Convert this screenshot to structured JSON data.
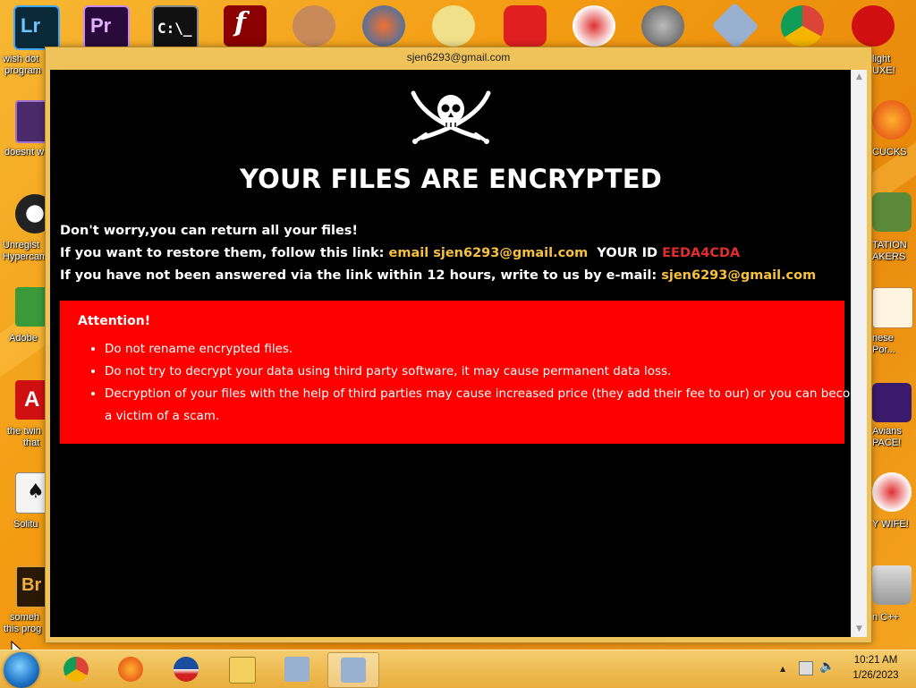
{
  "window": {
    "title": "sjen6293@gmail.com"
  },
  "note": {
    "headline": "YOUR FILES ARE ENCRYPTED",
    "line1": "Don't worry,you can return all your files!",
    "line2_prefix": "If you want to restore them, follow this link: ",
    "line2_link": "email sjen6293@gmail.com",
    "line2_id_label": "YOUR ID",
    "line2_id": "EEDA4CDA",
    "line3_prefix": "If you have not been answered via the link within 12 hours, write to us by e-mail: ",
    "line3_email": "sjen6293@gmail.com",
    "attention_title": "Attention!",
    "attention_items": [
      "Do not rename encrypted files.",
      "Do not try to decrypt your data using third party software, it may cause permanent data loss.",
      "Decryption of your files with the help of third parties may cause increased price (they add their fee to our) or you can become a victim of a scam."
    ]
  },
  "desktop": {
    "left_labels": [
      "wish dot",
      "program",
      "doesnt w",
      "Unregist",
      "Hypercam",
      "Adobe",
      "the twin",
      "that",
      "Solitu",
      "someh",
      "this prog"
    ],
    "right_labels": [
      "light",
      "UXE!",
      "CUCKS",
      "TATION",
      "AKERS",
      "nese",
      "Por...",
      "Avians",
      "PACE!",
      "Y WIFE!",
      "n C++"
    ]
  },
  "taskbar": {
    "time": "10:21 AM",
    "date": "1/26/2023"
  },
  "colors": {
    "background": "#000000",
    "accent_yellow": "#f7c23a",
    "id_red": "#e32d2d",
    "attention_box": "#ff0000"
  }
}
